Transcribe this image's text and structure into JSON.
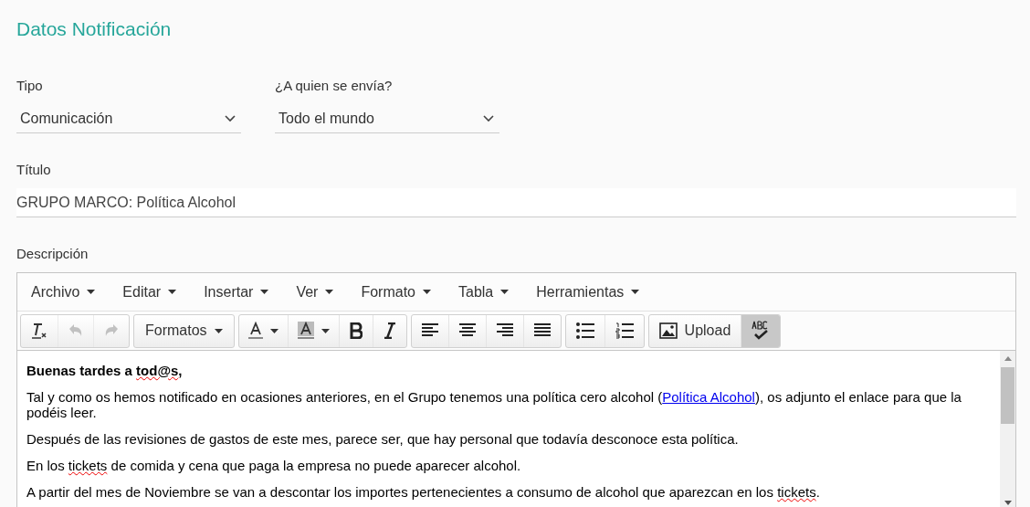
{
  "heading": "Datos Notificación",
  "fields": [
    {
      "label": "Tipo",
      "value": "Comunicación"
    },
    {
      "label": "¿A quien se envía?",
      "value": "Todo el mundo"
    }
  ],
  "title_field": {
    "label": "Título",
    "value": "GRUPO MARCO: Política Alcohol"
  },
  "description_label": "Descripción",
  "editor": {
    "menu": [
      "Archivo",
      "Editar",
      "Insertar",
      "Ver",
      "Formato",
      "Tabla",
      "Herramientas"
    ],
    "toolbar": [
      [
        {
          "kind": "clear-format",
          "disabled": false,
          "active": false
        },
        {
          "kind": "undo",
          "disabled": true,
          "active": false
        },
        {
          "kind": "redo",
          "disabled": true,
          "active": false
        }
      ],
      [
        {
          "kind": "dropdown",
          "label": "Formatos",
          "disabled": false,
          "active": false
        }
      ],
      [
        {
          "kind": "text-color",
          "disabled": false,
          "active": false
        },
        {
          "kind": "background-color",
          "disabled": false,
          "active": false
        },
        {
          "kind": "bold",
          "disabled": false,
          "active": false
        },
        {
          "kind": "italic",
          "disabled": false,
          "active": false
        }
      ],
      [
        {
          "kind": "align-left",
          "disabled": false,
          "active": false
        },
        {
          "kind": "align-center",
          "disabled": false,
          "active": false
        },
        {
          "kind": "align-right",
          "disabled": false,
          "active": false
        },
        {
          "kind": "justify",
          "disabled": false,
          "active": false
        }
      ],
      [
        {
          "kind": "bullet-list",
          "disabled": false,
          "active": false
        },
        {
          "kind": "numbered-list",
          "disabled": false,
          "active": false
        }
      ],
      [
        {
          "kind": "image",
          "label": "Upload",
          "disabled": false,
          "active": false
        },
        {
          "kind": "spellcheck",
          "disabled": false,
          "active": true
        }
      ]
    ],
    "paragraphs": [
      {
        "bold": true,
        "segments": [
          {
            "kind": "text",
            "text": "Buenas tardes a "
          },
          {
            "kind": "misspelled",
            "text": "tod@s"
          },
          {
            "kind": "text",
            "text": ","
          }
        ]
      },
      {
        "bold": false,
        "segments": [
          {
            "kind": "text",
            "text": "Tal y como os hemos notificado en ocasiones anteriores, en el Grupo tenemos una política cero alcohol ("
          },
          {
            "kind": "link",
            "text": "Política Alcohol"
          },
          {
            "kind": "text",
            "text": "), os adjunto el enlace para que la podéis leer."
          }
        ]
      },
      {
        "bold": false,
        "segments": [
          {
            "kind": "text",
            "text": "Después de las revisiones de gastos de este mes, parece ser, que hay personal que todavía desconoce esta política."
          }
        ]
      },
      {
        "bold": false,
        "segments": [
          {
            "kind": "text",
            "text": "En los "
          },
          {
            "kind": "misspelled",
            "text": "tickets"
          },
          {
            "kind": "text",
            "text": " de comida y cena que paga la empresa no puede aparecer alcohol."
          }
        ]
      },
      {
        "bold": false,
        "segments": [
          {
            "kind": "text",
            "text": "A partir del mes de Noviembre se van a descontar los importes pertenecientes a consumo de alcohol que aparezcan en los "
          },
          {
            "kind": "misspelled",
            "text": "tickets"
          },
          {
            "kind": "text",
            "text": "."
          }
        ]
      }
    ]
  }
}
